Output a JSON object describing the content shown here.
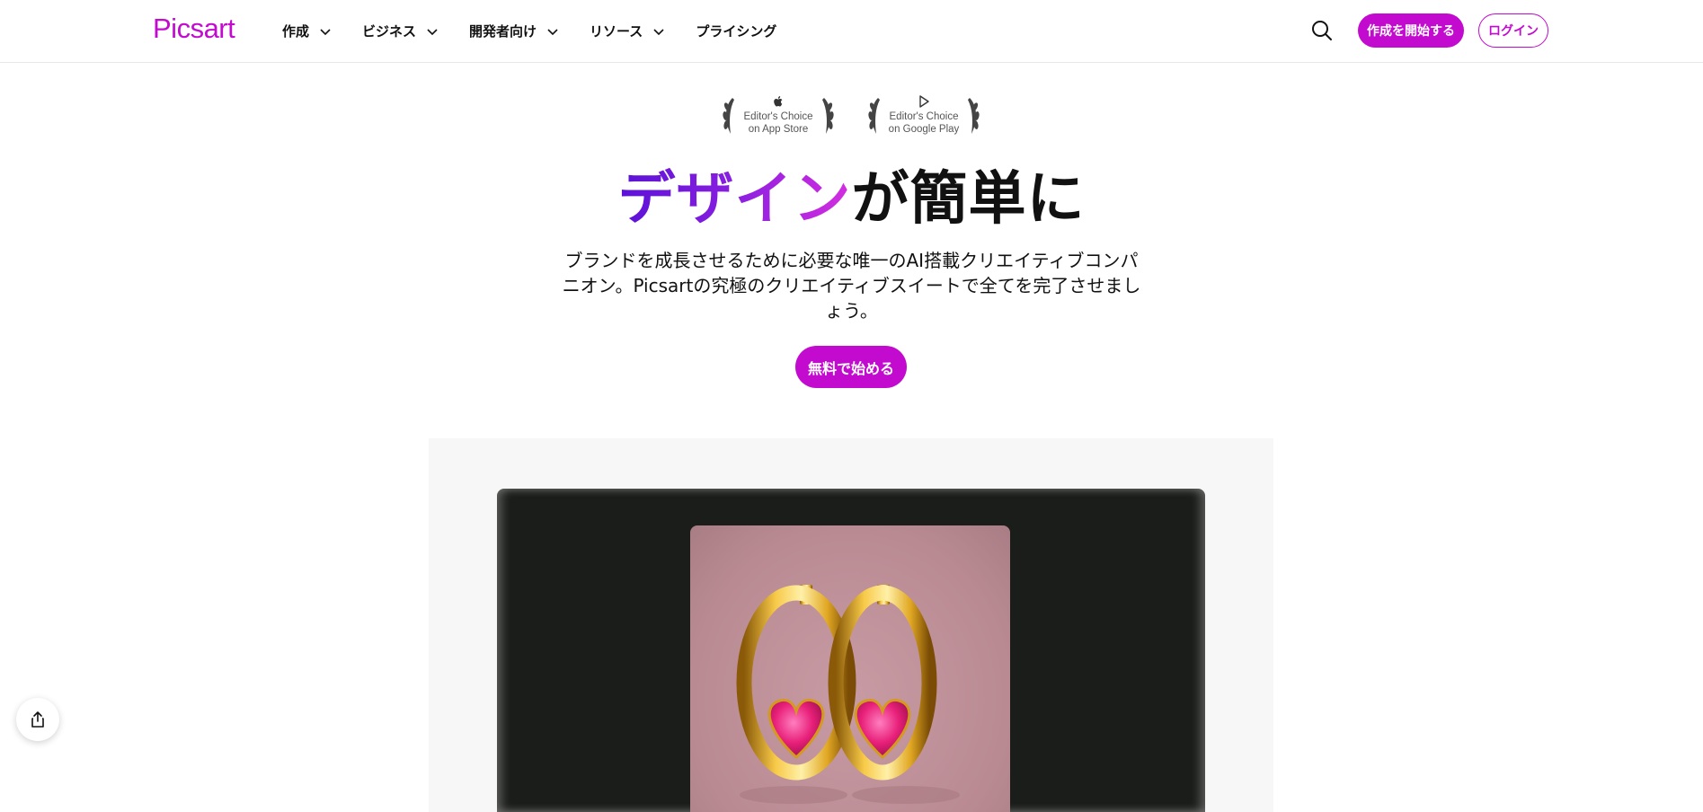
{
  "header": {
    "logo": "Picsart",
    "nav": [
      {
        "label": "作成"
      },
      {
        "label": "ビジネス"
      },
      {
        "label": "開発者向け"
      },
      {
        "label": "リソース"
      },
      {
        "label": "プライシング"
      }
    ],
    "start_button": "作成を開始する",
    "login_button": "ログイン"
  },
  "badges": [
    {
      "line1": "Editor's Choice",
      "line2": "on App Store",
      "icon": "apple-icon"
    },
    {
      "line1": "Editor's Choice",
      "line2": "on Google Play",
      "icon": "google-play-icon"
    }
  ],
  "hero": {
    "title_highlight": "デザイン",
    "title_rest": "が簡単に",
    "subtitle": "ブランドを成長させるために必要な唯一のAI搭載クリエイティブコンパニオン。Picsartの究極のクリエイティブスイートで全てを完了させましょう。",
    "cta": "無料で始める"
  },
  "colors": {
    "brand": "#c20bcf",
    "gradient_start": "#5a12d6",
    "gradient_end": "#d52ee0"
  },
  "icons": {
    "search": "search-icon",
    "share": "share-icon",
    "chevron": "chevron-down-icon"
  }
}
